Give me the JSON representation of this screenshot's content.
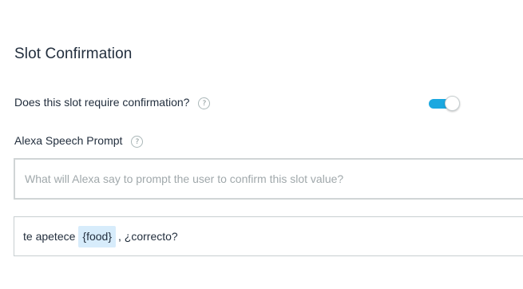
{
  "section": {
    "title": "Slot Confirmation"
  },
  "confirmation": {
    "label": "Does this slot require confirmation?",
    "help_glyph": "?",
    "enabled": true,
    "accent_color": "#1ba8e0"
  },
  "speech_prompt": {
    "label": "Alexa Speech Prompt",
    "help_glyph": "?",
    "placeholder": "What will Alexa say to prompt the user to confirm this slot value?",
    "value": ""
  },
  "utterance": {
    "before_text": "te apetece",
    "slot": "{food}",
    "after_text": ", ¿correcto?",
    "slot_highlight_color": "#d7ecfb"
  }
}
